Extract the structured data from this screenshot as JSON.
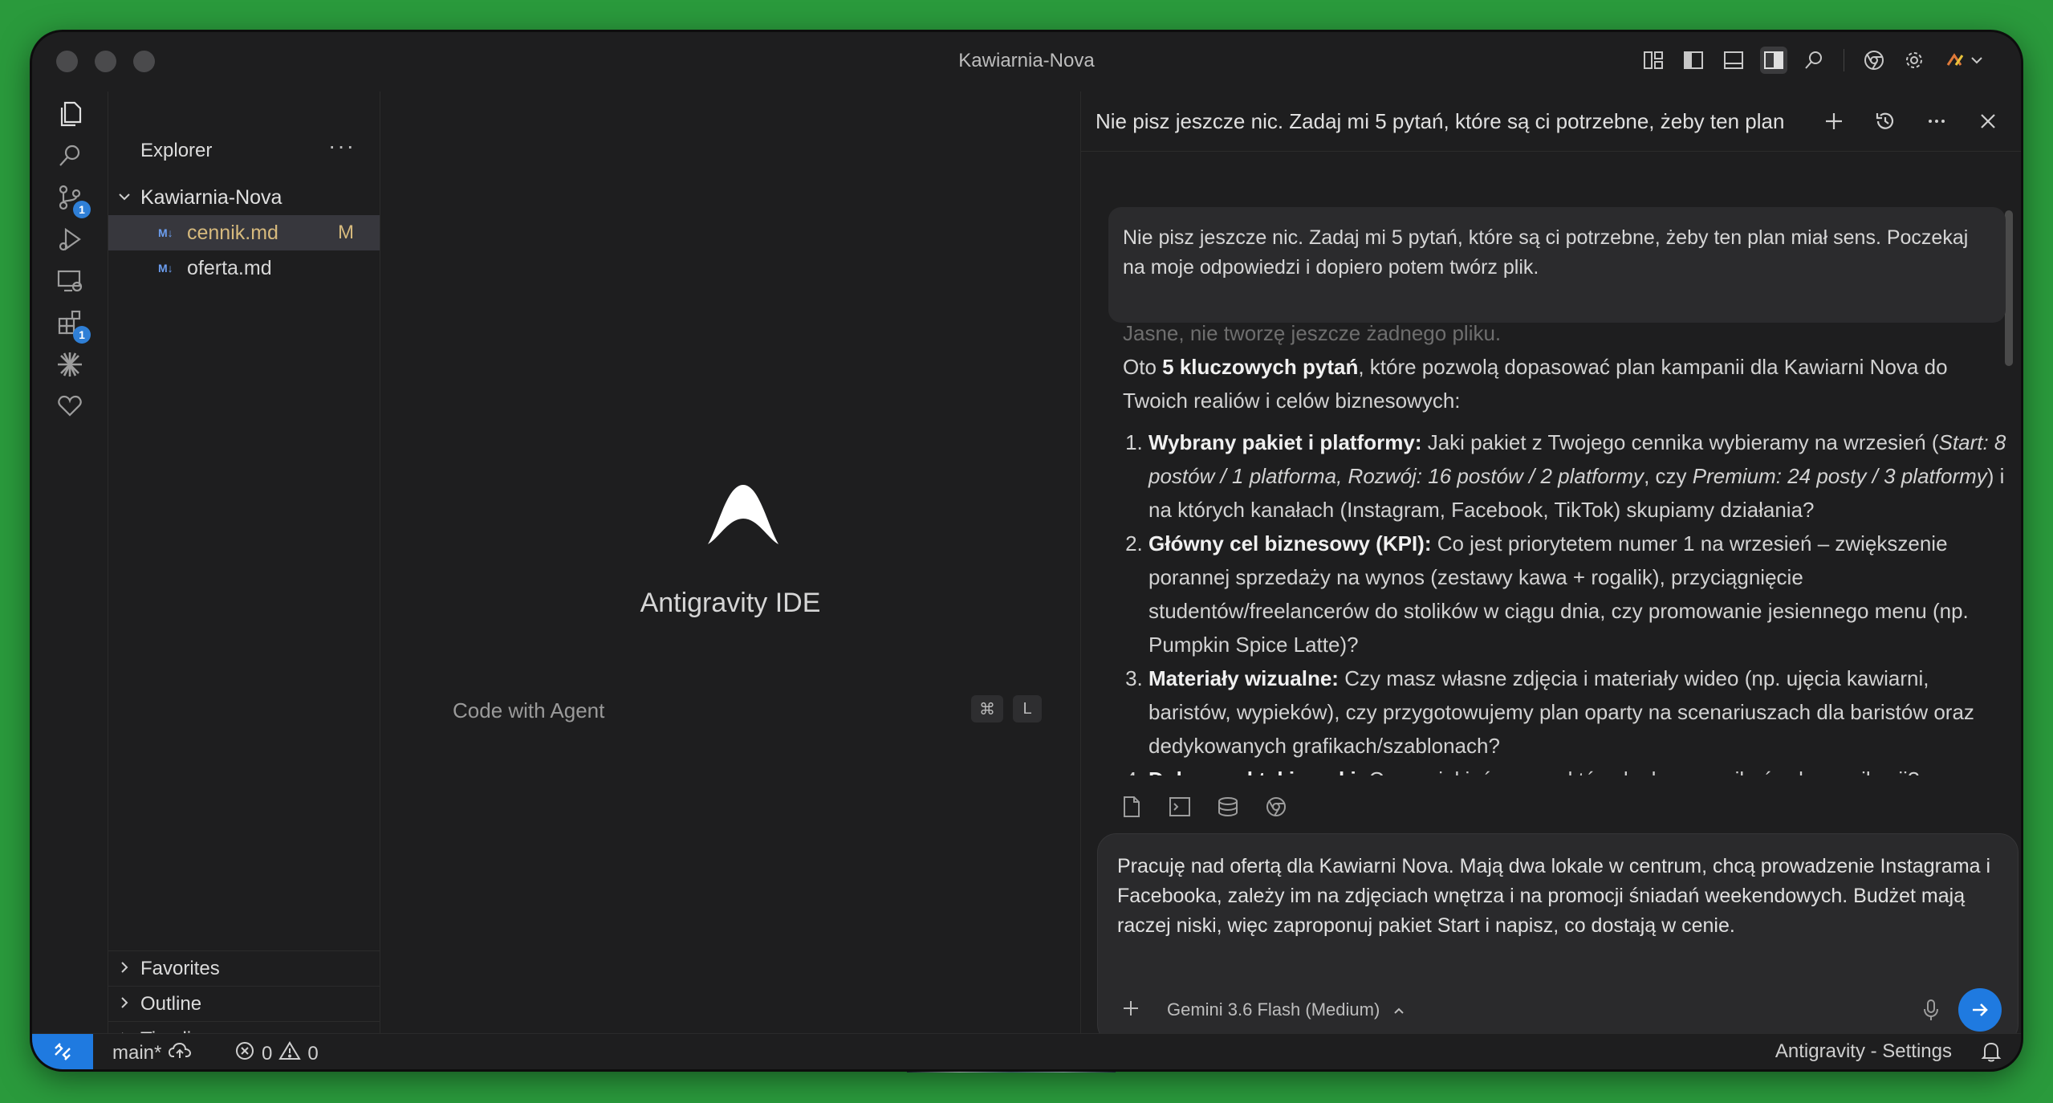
{
  "window": {
    "title": "Kawiarnia-Nova"
  },
  "explorer": {
    "title": "Explorer",
    "more": "···",
    "root": "Kawiarnia-Nova",
    "files": [
      {
        "badge": "M↓",
        "name": "cennik.md",
        "status": "M"
      },
      {
        "badge": "M↓",
        "name": "oferta.md",
        "status": ""
      }
    ],
    "sections": [
      "Favorites",
      "Outline",
      "Timeline"
    ]
  },
  "activity": {
    "scm_badge": "1",
    "ext_badge": "1"
  },
  "editor": {
    "app_name": "Antigravity IDE",
    "code_with_agent": "Code with Agent",
    "shortcut_mod": "⌘",
    "shortcut_key": "L"
  },
  "agent": {
    "title": "Nie pisz jeszcze nic. Zadaj mi 5 pytań, które są ci potrzebne, żeby ten plan",
    "user_message": "Nie pisz jeszcze nic. Zadaj mi 5 pytań, które są ci potrzebne, żeby ten plan miał sens. Poczekaj na moje odpowiedzi i dopiero potem twórz plik.",
    "answer": {
      "faded_line": "Jasne, nie tworzę jeszcze żadnego pliku.",
      "intro_pre": "Oto ",
      "intro_bold": "5 kluczowych pytań",
      "intro_post": ", które pozwolą dopasować plan kampanii dla Kawiarni Nova do Twoich realiów i celów biznesowych:",
      "q1_bold": "Wybrany pakiet i platformy:",
      "q1_a": " Jaki pakiet z Twojego cennika wybieramy na wrzesień (",
      "q1_i1": "Start: 8 postów / 1 platforma, Rozwój: 16 postów / 2 platformy",
      "q1_b": ", czy ",
      "q1_i2": "Premium: 24 posty / 3 platformy",
      "q1_c": ") i na których kanałach (Instagram, Facebook, TikTok) skupiamy działania?",
      "q2_bold": "Główny cel biznesowy (KPI):",
      "q2_text": " Co jest priorytetem numer 1 na wrzesień – zwiększenie porannej sprzedaży na wynos (zestawy kawa + rogalik), przyciągnięcie studentów/freelancerów do stolików w ciągu dnia, czy promowanie jesiennego menu (np. Pumpkin Spice Latte)?",
      "q3_bold": "Materiały wizualne:",
      "q3_text": " Czy masz własne zdjęcia i materiały wideo (np. ujęcia kawiarni, baristów, wypieków), czy przygotowujemy plan oparty na scenariuszach dla baristów oraz dedykowanych grafikach/szablonach?",
      "q4_bold": "Dobre praktyki marki:",
      "q4_text": " Czy są jakieś rzeczy, których chcesz unikać w komunikacji?"
    },
    "input_text": "Pracuję nad ofertą dla Kawiarni Nova. Mają dwa lokale w centrum, chcą prowadzenie Instagrama i Facebooka, zależy im na zdjęciach wnętrza i na promocji śniadań weekendowych. Budżet mają raczej niski, więc zaproponuj pakiet Start i napisz, co dostają w cenie.",
    "model_label": "Gemini 3.6 Flash (Medium)"
  },
  "status": {
    "branch": "main*",
    "errors": "0",
    "warnings": "0",
    "settings": "Antigravity - Settings"
  },
  "colors": {
    "accent": "#1f7ae0",
    "modified": "#d7ba7d",
    "background": "#1e1e1f"
  }
}
